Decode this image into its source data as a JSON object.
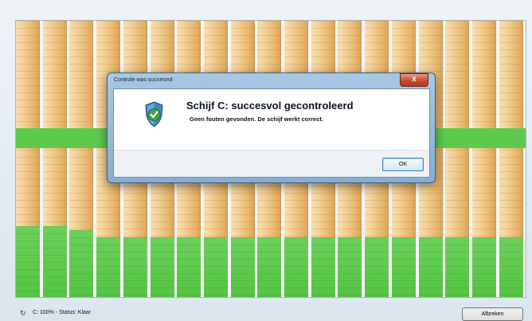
{
  "dialog": {
    "title": "Controle was succesvol",
    "heading": "Schijf C: succesvol gecontroleerd",
    "message": "Geen fouten gevonden. De schijf werkt correct.",
    "ok_label": "OK",
    "close_glyph": "x"
  },
  "status": {
    "text": "C: 100% - Status: Klaar",
    "icon": "spinner-icon"
  },
  "actions": {
    "cancel_label": "Afbreken"
  },
  "colors": {
    "block_orange": "#f3cf93",
    "block_green": "#5fc94d",
    "dialog_frame": "#9bbcdc",
    "close_button": "#c84a32"
  }
}
